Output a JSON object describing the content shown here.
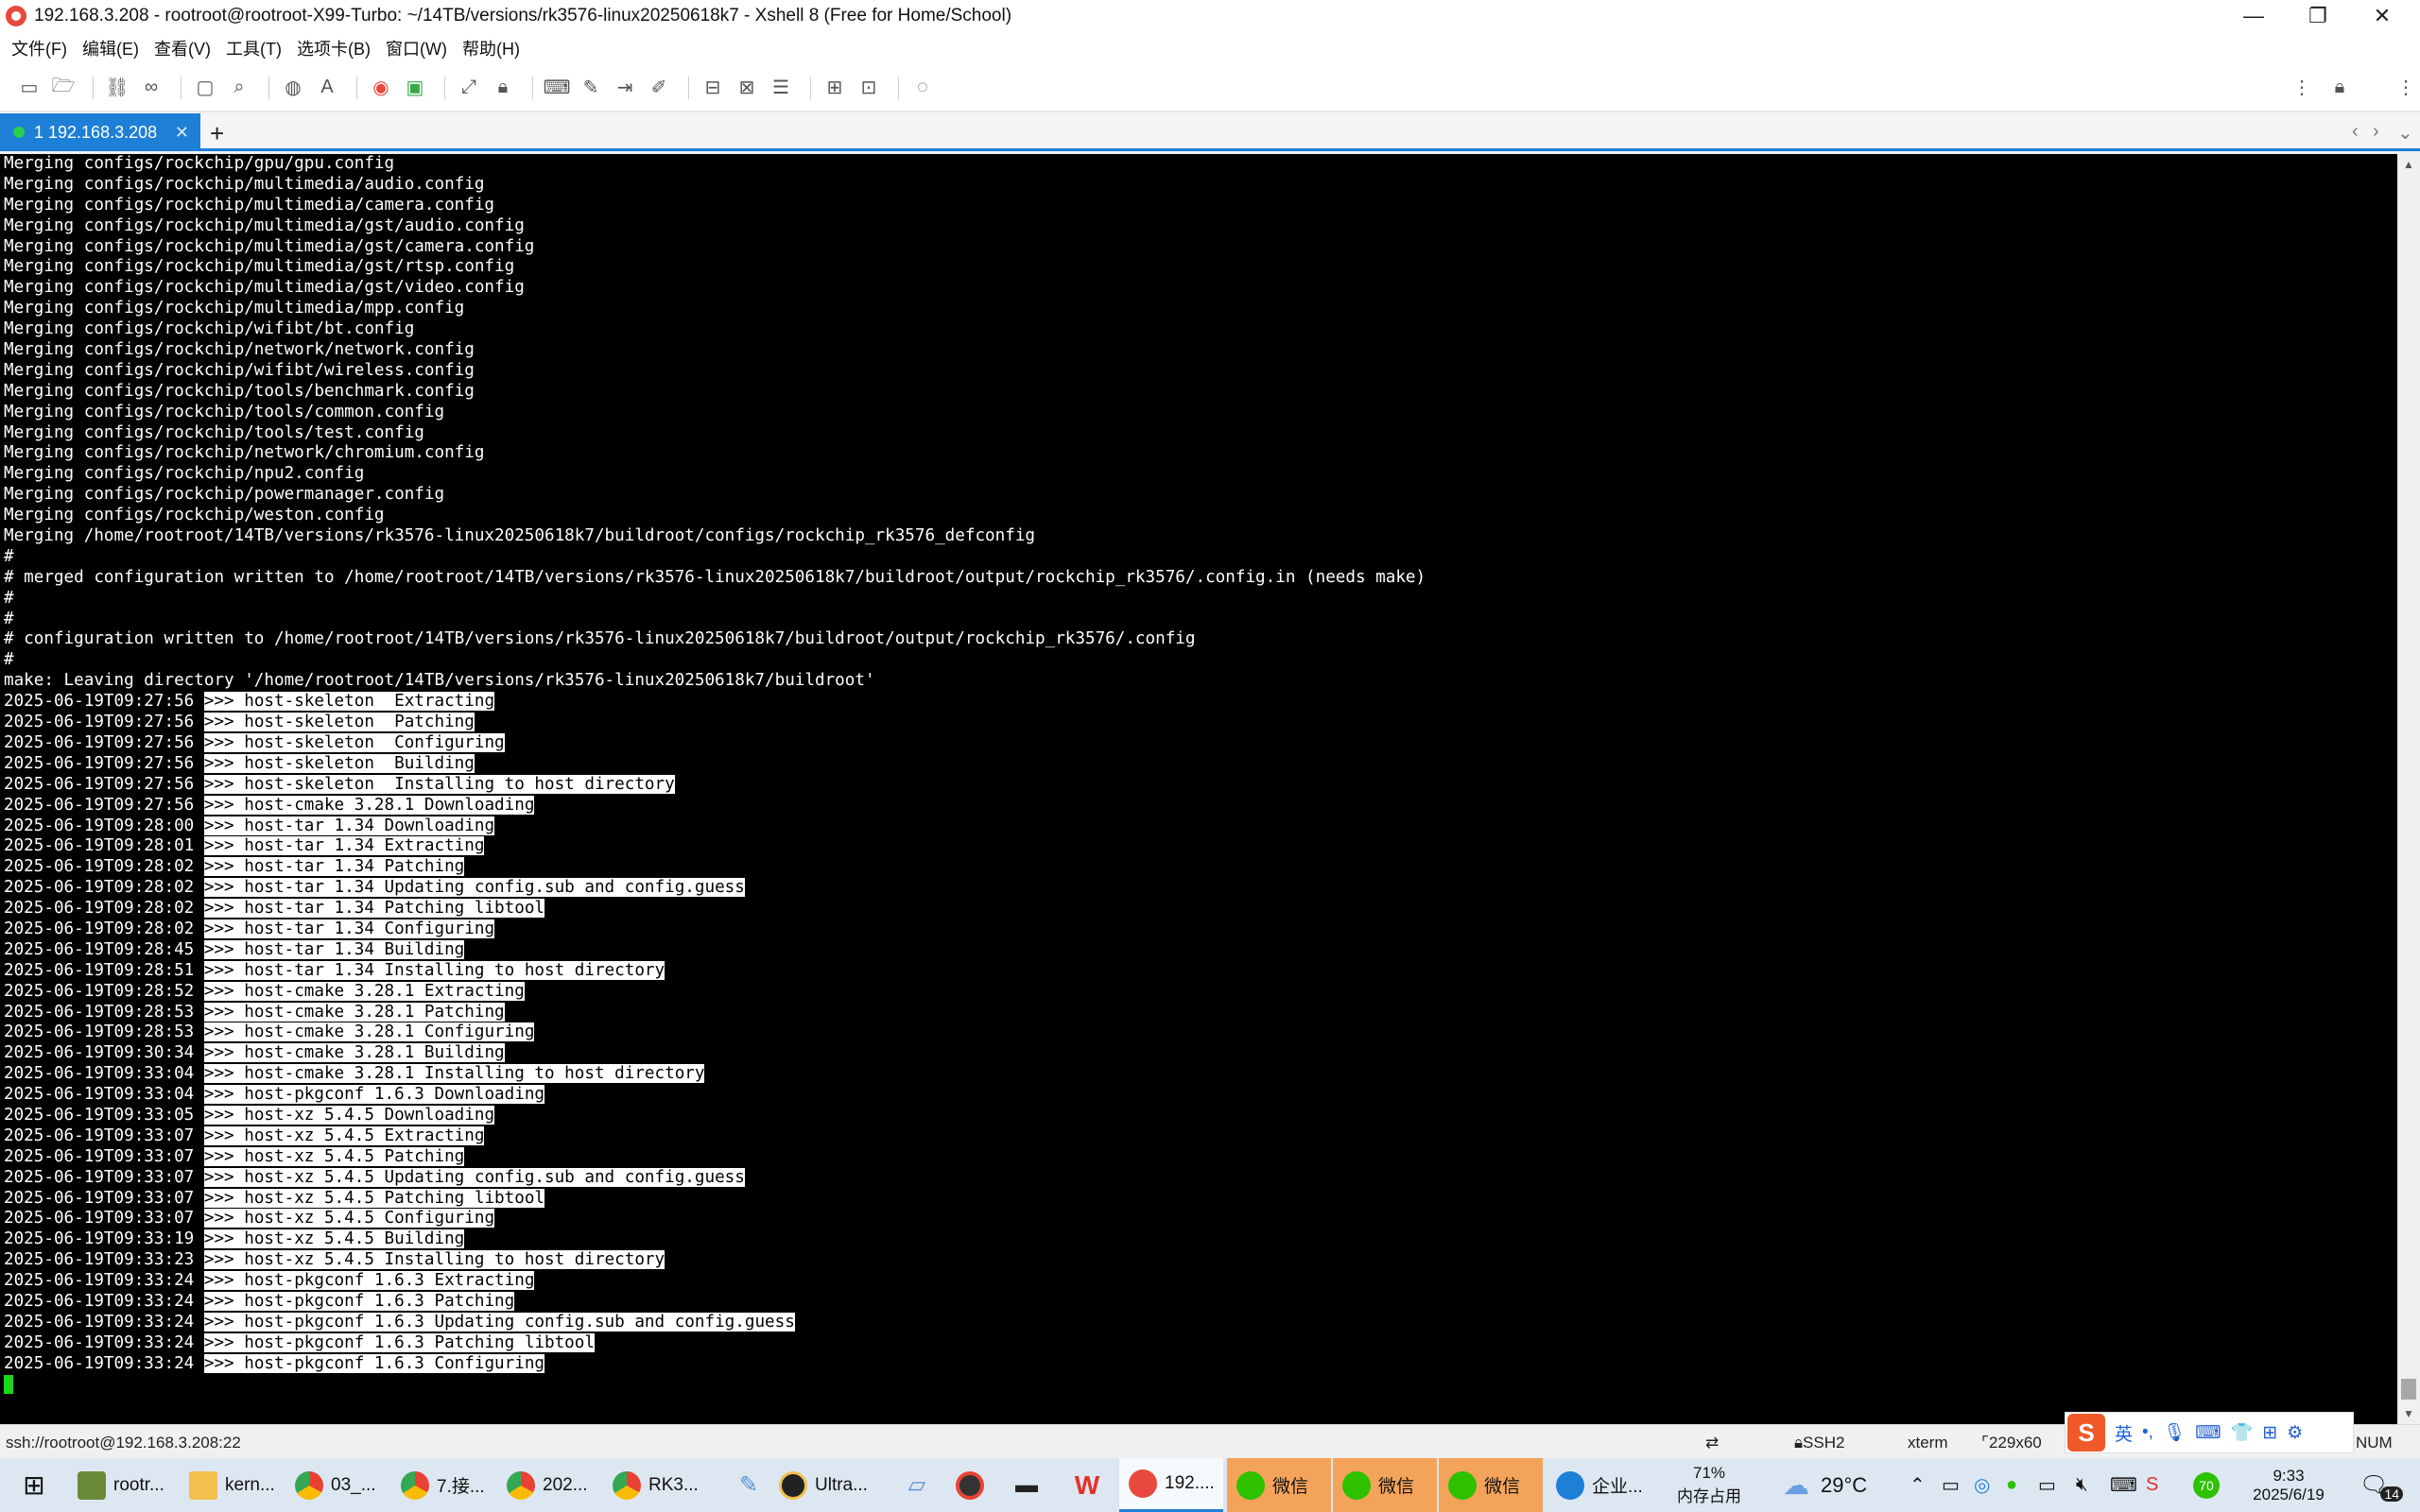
{
  "window": {
    "title": "192.168.3.208 - rootroot@rootroot-X99-Turbo: ~/14TB/versions/rk3576-linux20250618k7 - Xshell 8 (Free for Home/School)",
    "controls": {
      "minimize": "—",
      "maximize": "❐",
      "close": "✕"
    }
  },
  "menu": [
    "文件(F)",
    "编辑(E)",
    "查看(V)",
    "工具(T)",
    "选项卡(B)",
    "窗口(W)",
    "帮助(H)"
  ],
  "tab": {
    "label": "1 192.168.3.208",
    "close": "✕",
    "add": "+",
    "nav_left": "‹",
    "nav_right": "›",
    "nav_menu": "⌄"
  },
  "terminal": {
    "lines": [
      {
        "t": "Merging configs/rockchip/gpu/gpu.config"
      },
      {
        "t": "Merging configs/rockchip/multimedia/audio.config"
      },
      {
        "t": "Merging configs/rockchip/multimedia/camera.config"
      },
      {
        "t": "Merging configs/rockchip/multimedia/gst/audio.config"
      },
      {
        "t": "Merging configs/rockchip/multimedia/gst/camera.config"
      },
      {
        "t": "Merging configs/rockchip/multimedia/gst/rtsp.config"
      },
      {
        "t": "Merging configs/rockchip/multimedia/gst/video.config"
      },
      {
        "t": "Merging configs/rockchip/multimedia/mpp.config"
      },
      {
        "t": "Merging configs/rockchip/wifibt/bt.config"
      },
      {
        "t": "Merging configs/rockchip/network/network.config"
      },
      {
        "t": "Merging configs/rockchip/wifibt/wireless.config"
      },
      {
        "t": "Merging configs/rockchip/tools/benchmark.config"
      },
      {
        "t": "Merging configs/rockchip/tools/common.config"
      },
      {
        "t": "Merging configs/rockchip/tools/test.config"
      },
      {
        "t": "Merging configs/rockchip/network/chromium.config"
      },
      {
        "t": "Merging configs/rockchip/npu2.config"
      },
      {
        "t": "Merging configs/rockchip/powermanager.config"
      },
      {
        "t": "Merging configs/rockchip/weston.config"
      },
      {
        "t": "Merging /home/rootroot/14TB/versions/rk3576-linux20250618k7/buildroot/configs/rockchip_rk3576_defconfig"
      },
      {
        "t": "#"
      },
      {
        "t": "# merged configuration written to /home/rootroot/14TB/versions/rk3576-linux20250618k7/buildroot/output/rockchip_rk3576/.config.in (needs make)"
      },
      {
        "t": "#"
      },
      {
        "t": "#"
      },
      {
        "t": "# configuration written to /home/rootroot/14TB/versions/rk3576-linux20250618k7/buildroot/output/rockchip_rk3576/.config"
      },
      {
        "t": "#"
      },
      {
        "t": "make: Leaving directory '/home/rootroot/14TB/versions/rk3576-linux20250618k7/buildroot'"
      },
      {
        "ts": "2025-06-19T09:27:56",
        "h": ">>> host-skeleton  Extracting"
      },
      {
        "ts": "2025-06-19T09:27:56",
        "h": ">>> host-skeleton  Patching"
      },
      {
        "ts": "2025-06-19T09:27:56",
        "h": ">>> host-skeleton  Configuring"
      },
      {
        "ts": "2025-06-19T09:27:56",
        "h": ">>> host-skeleton  Building"
      },
      {
        "ts": "2025-06-19T09:27:56",
        "h": ">>> host-skeleton  Installing to host directory"
      },
      {
        "ts": "2025-06-19T09:27:56",
        "h": ">>> host-cmake 3.28.1 Downloading"
      },
      {
        "ts": "2025-06-19T09:28:00",
        "h": ">>> host-tar 1.34 Downloading"
      },
      {
        "ts": "2025-06-19T09:28:01",
        "h": ">>> host-tar 1.34 Extracting"
      },
      {
        "ts": "2025-06-19T09:28:02",
        "h": ">>> host-tar 1.34 Patching"
      },
      {
        "ts": "2025-06-19T09:28:02",
        "h": ">>> host-tar 1.34 Updating config.sub and config.guess"
      },
      {
        "ts": "2025-06-19T09:28:02",
        "h": ">>> host-tar 1.34 Patching libtool"
      },
      {
        "ts": "2025-06-19T09:28:02",
        "h": ">>> host-tar 1.34 Configuring"
      },
      {
        "ts": "2025-06-19T09:28:45",
        "h": ">>> host-tar 1.34 Building"
      },
      {
        "ts": "2025-06-19T09:28:51",
        "h": ">>> host-tar 1.34 Installing to host directory"
      },
      {
        "ts": "2025-06-19T09:28:52",
        "h": ">>> host-cmake 3.28.1 Extracting"
      },
      {
        "ts": "2025-06-19T09:28:53",
        "h": ">>> host-cmake 3.28.1 Patching"
      },
      {
        "ts": "2025-06-19T09:28:53",
        "h": ">>> host-cmake 3.28.1 Configuring"
      },
      {
        "ts": "2025-06-19T09:30:34",
        "h": ">>> host-cmake 3.28.1 Building"
      },
      {
        "ts": "2025-06-19T09:33:04",
        "h": ">>> host-cmake 3.28.1 Installing to host directory"
      },
      {
        "ts": "2025-06-19T09:33:04",
        "h": ">>> host-pkgconf 1.6.3 Downloading"
      },
      {
        "ts": "2025-06-19T09:33:05",
        "h": ">>> host-xz 5.4.5 Downloading"
      },
      {
        "ts": "2025-06-19T09:33:07",
        "h": ">>> host-xz 5.4.5 Extracting"
      },
      {
        "ts": "2025-06-19T09:33:07",
        "h": ">>> host-xz 5.4.5 Patching"
      },
      {
        "ts": "2025-06-19T09:33:07",
        "h": ">>> host-xz 5.4.5 Updating config.sub and config.guess"
      },
      {
        "ts": "2025-06-19T09:33:07",
        "h": ">>> host-xz 5.4.5 Patching libtool"
      },
      {
        "ts": "2025-06-19T09:33:07",
        "h": ">>> host-xz 5.4.5 Configuring"
      },
      {
        "ts": "2025-06-19T09:33:19",
        "h": ">>> host-xz 5.4.5 Building"
      },
      {
        "ts": "2025-06-19T09:33:23",
        "h": ">>> host-xz 5.4.5 Installing to host directory"
      },
      {
        "ts": "2025-06-19T09:33:24",
        "h": ">>> host-pkgconf 1.6.3 Extracting"
      },
      {
        "ts": "2025-06-19T09:33:24",
        "h": ">>> host-pkgconf 1.6.3 Patching"
      },
      {
        "ts": "2025-06-19T09:33:24",
        "h": ">>> host-pkgconf 1.6.3 Updating config.sub and config.guess"
      },
      {
        "ts": "2025-06-19T09:33:24",
        "h": ">>> host-pkgconf 1.6.3 Patching libtool"
      },
      {
        "ts": "2025-06-19T09:33:24",
        "h": ">>> host-pkgconf 1.6.3 Configuring"
      }
    ],
    "cursor_color": "#1bd61b"
  },
  "status": {
    "connection": "ssh://rootroot@192.168.3.208:22",
    "protocol": "SSH2",
    "term": "xterm",
    "size": "229x60",
    "num": "NUM"
  },
  "ime": {
    "mode": "英",
    "punct": "•,",
    "logo": "S"
  },
  "taskbar": {
    "items": [
      {
        "label": "rootr...",
        "color": "#6a8a3a"
      },
      {
        "label": "kern...",
        "color": "#f2c14e"
      },
      {
        "label": "03_...",
        "color": "#e94235"
      },
      {
        "label": "7.接...",
        "color": "#e94235"
      },
      {
        "label": "202...",
        "color": "#e94235"
      },
      {
        "label": "RK3...",
        "color": "#e94235"
      },
      {
        "label": "Ultra...",
        "color": "#222222"
      },
      {
        "label": "192....",
        "color": "#e8493e"
      },
      {
        "label": "微信",
        "color": "#2dc100"
      },
      {
        "label": "微信",
        "color": "#2dc100"
      },
      {
        "label": "微信",
        "color": "#2dc100"
      },
      {
        "label": "企业...",
        "color": "#1e7fd6"
      }
    ],
    "memory_percent": "71%",
    "memory_label": "内存占用",
    "weather": "29°C",
    "clock_time": "9:33",
    "clock_date": "2025/6/19",
    "notifications": "14",
    "badge": "70"
  },
  "colors": {
    "accent": "#1e7fd6",
    "terminal_bg": "#000000",
    "wechat": "#f4a35a"
  }
}
